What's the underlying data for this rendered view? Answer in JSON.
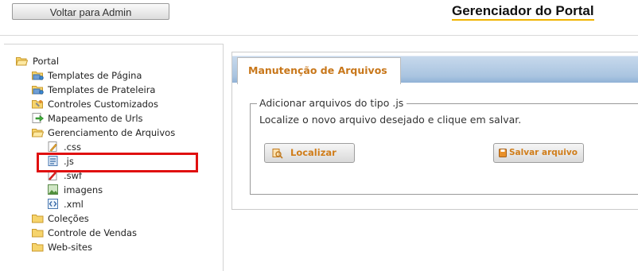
{
  "header": {
    "back_button": "Voltar para Admin",
    "title": "Gerenciador do Portal"
  },
  "tree": {
    "root": "Portal",
    "items": [
      {
        "label": "Templates de Página",
        "icon": "template-folder-icon"
      },
      {
        "label": "Templates de Prateleira",
        "icon": "template-folder-icon"
      },
      {
        "label": "Controles Customizados",
        "icon": "controls-folder-icon"
      },
      {
        "label": "Mapeamento de Urls",
        "icon": "arrow-page-icon"
      },
      {
        "label": "Gerenciamento de Arquivos",
        "icon": "open-folder-icon"
      },
      {
        "label": ".css",
        "icon": "css-file-icon"
      },
      {
        "label": ".js",
        "icon": "js-file-icon"
      },
      {
        "label": ".swf",
        "icon": "swf-file-icon"
      },
      {
        "label": "imagens",
        "icon": "image-file-icon"
      },
      {
        "label": ".xml",
        "icon": "xml-file-icon"
      },
      {
        "label": "Coleções",
        "icon": "folder-icon"
      },
      {
        "label": "Controle de Vendas",
        "icon": "folder-icon"
      },
      {
        "label": "Web-sites",
        "icon": "folder-icon"
      }
    ]
  },
  "panel": {
    "tab_label": "Manutenção de Arquivos",
    "legend": "Adicionar arquivos do tipo .js",
    "instruction": "Localize o novo arquivo desejado e clique em salvar.",
    "locate_button": "Localizar",
    "save_button": "Salvar arquivo"
  },
  "colors": {
    "accent_orange": "#c8771a",
    "tab_strip_blue": "#a9c4e0",
    "highlight_red": "#e01010",
    "title_underline": "#f0b400"
  }
}
